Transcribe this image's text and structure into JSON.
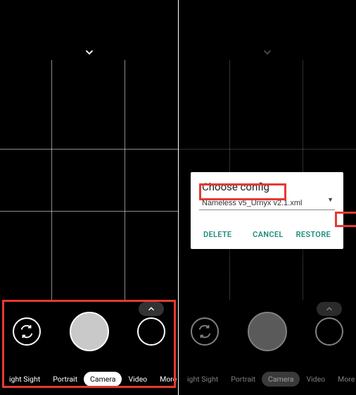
{
  "left": {
    "modes": [
      "ight Sight",
      "Portrait",
      "Camera",
      "Video",
      "More"
    ],
    "active_index": 2
  },
  "right": {
    "modes": [
      "ight Sight",
      "Portrait",
      "Camera",
      "Video",
      "More"
    ],
    "active_index": 2,
    "dialog": {
      "title": "Choose config",
      "file": "Nameless v5_Urnyx v2.1.xml",
      "delete": "DELETE",
      "cancel": "CANCEL",
      "restore": "RESTORE"
    }
  }
}
